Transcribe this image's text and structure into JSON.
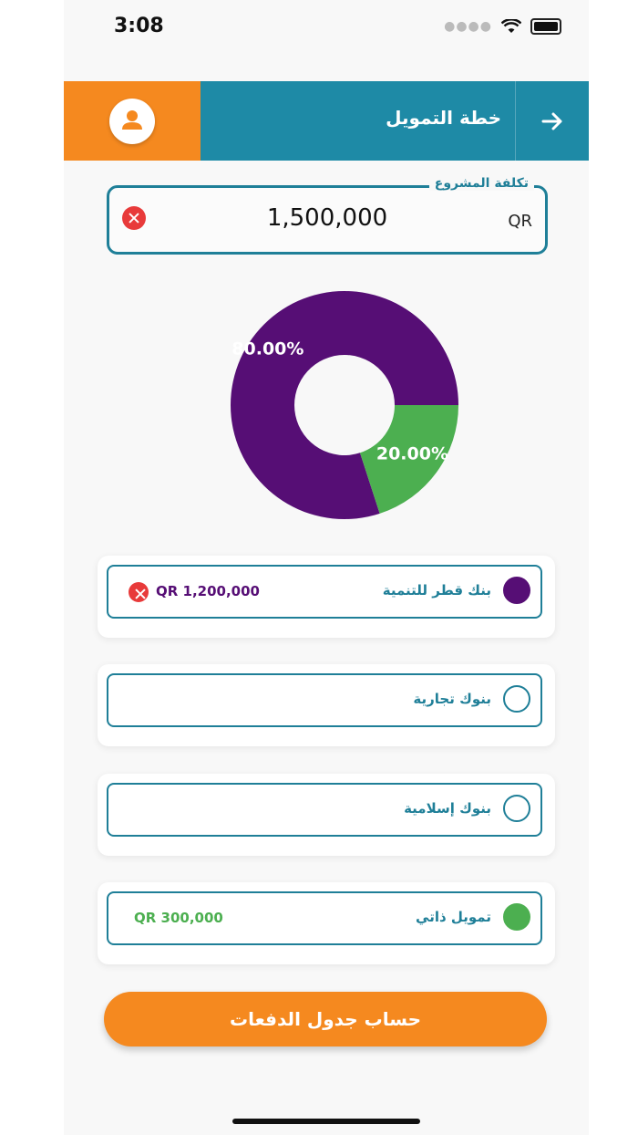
{
  "status_bar": {
    "time": "3:08"
  },
  "header": {
    "title": "خطة التمويل"
  },
  "project_cost": {
    "label": "تكلفة المشروع",
    "value": "1,500,000",
    "currency": "QR"
  },
  "chart_data": {
    "type": "pie",
    "categories": [
      "بنك قطر للتنمية",
      "تمويل ذاتي"
    ],
    "values": [
      80.0,
      20.0
    ],
    "labels": [
      "80.00%",
      "20.00%"
    ],
    "colors": [
      "#560e75",
      "#4caf50"
    ]
  },
  "options": [
    {
      "label": "بنك قطر للتنمية",
      "amount": "QR 1,200,000",
      "selected": true,
      "color": "#560e75"
    },
    {
      "label": "بنوك تجارية",
      "amount": "",
      "selected": false,
      "color": ""
    },
    {
      "label": "بنوك إسلامية",
      "amount": "",
      "selected": false,
      "color": ""
    },
    {
      "label": "تمويل ذاتي",
      "amount": "QR 300,000",
      "selected": true,
      "color": "#4caf50"
    }
  ],
  "calculate_button": {
    "label": "حساب جدول الدفعات"
  },
  "colors": {
    "primary": "#1e8aa6",
    "accent": "#f5891f",
    "danger": "#e83a3a"
  }
}
